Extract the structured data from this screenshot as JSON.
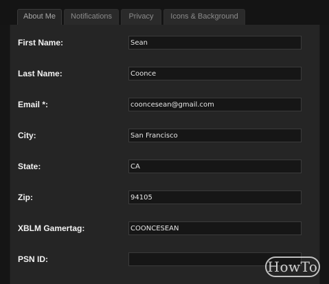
{
  "tabs": [
    {
      "label": "About Me",
      "active": true
    },
    {
      "label": "Notifications",
      "active": false
    },
    {
      "label": "Privacy",
      "active": false
    },
    {
      "label": "Icons & Background",
      "active": false
    }
  ],
  "form": {
    "first_name": {
      "label": "First Name:",
      "value": "Sean"
    },
    "last_name": {
      "label": "Last Name:",
      "value": "Coonce"
    },
    "email": {
      "label": "Email *:",
      "value": "cooncesean@gmail.com"
    },
    "city": {
      "label": "City:",
      "value": "San Francisco"
    },
    "state": {
      "label": "State:",
      "value": "CA"
    },
    "zip": {
      "label": "Zip:",
      "value": "94105"
    },
    "xblm_gamertag": {
      "label": "XBLM Gamertag:",
      "value": "COONCESEAN"
    },
    "psn_id": {
      "label": "PSN ID:",
      "value": ""
    }
  },
  "watermark": {
    "text": "HowTo"
  },
  "colors": {
    "page_background": "#151515",
    "panel_background": "#252525",
    "input_background": "#161616",
    "label_text": "#f2f2f2",
    "tab_text": "#8b8b8b"
  }
}
